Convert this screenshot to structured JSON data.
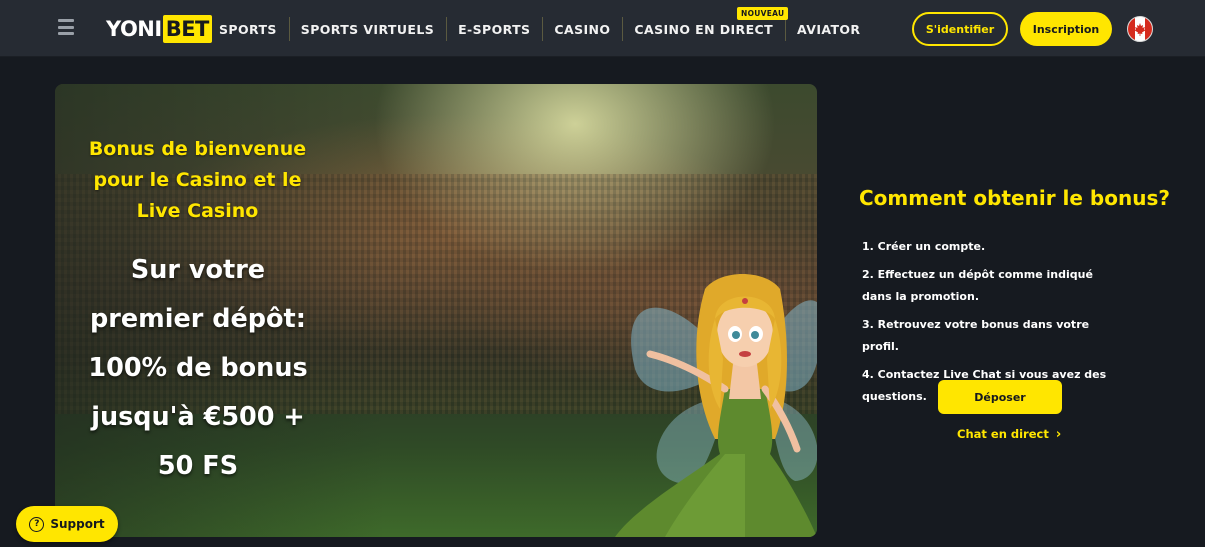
{
  "header": {
    "logo": {
      "left": "YONI",
      "right": "BET"
    },
    "nav": [
      {
        "label": "SPORTS"
      },
      {
        "label": "SPORTS VIRTUELS"
      },
      {
        "label": "E-SPORTS"
      },
      {
        "label": "CASINO"
      },
      {
        "label": "CASINO EN DIRECT"
      },
      {
        "label": "AVIATOR"
      }
    ],
    "new_badge": "NOUVEAU",
    "login_label": "S'identifier",
    "register_label": "Inscription",
    "locale_icon": "canada-flag-icon"
  },
  "hero": {
    "subtitle": "Bonus de bienvenue pour le Casino et le Live Casino",
    "title": "Sur votre premier dépôt: 100% de bonus jusqu'à €500 + 50 FS"
  },
  "how_to": {
    "title": "Comment obtenir le bonus?",
    "steps": [
      "1. Créer un compte.",
      "2. Effectuez un dépôt comme indiqué dans la promotion.",
      "3. Retrouvez votre bonus dans votre profil.",
      "4. Contactez Live Chat si vous avez des questions."
    ],
    "deposit_label": "Déposer",
    "chat_label": "Chat en direct"
  },
  "support": {
    "label": "Support",
    "icon": "question-icon"
  },
  "colors": {
    "accent": "#ffe600",
    "header_bg": "#262b33",
    "page_bg": "#161a20"
  }
}
